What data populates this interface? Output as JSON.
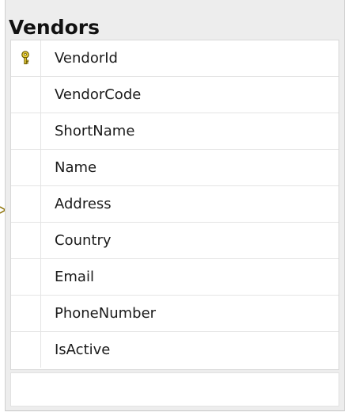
{
  "table": {
    "title": "Vendors",
    "columns": [
      {
        "name": "VendorId",
        "primary_key": true
      },
      {
        "name": "VendorCode",
        "primary_key": false
      },
      {
        "name": "ShortName",
        "primary_key": false
      },
      {
        "name": "Name",
        "primary_key": false
      },
      {
        "name": "Address",
        "primary_key": false
      },
      {
        "name": "Country",
        "primary_key": false
      },
      {
        "name": "Email",
        "primary_key": false
      },
      {
        "name": "PhoneNumber",
        "primary_key": false
      },
      {
        "name": "IsActive",
        "primary_key": false
      }
    ]
  },
  "icons": {
    "primary_key": "key-icon",
    "relationship": "relationship-connector-icon"
  },
  "colors": {
    "header_background": "#ededed",
    "key_icon": "#e5c52a",
    "relationship_line": "#8a6f00"
  }
}
